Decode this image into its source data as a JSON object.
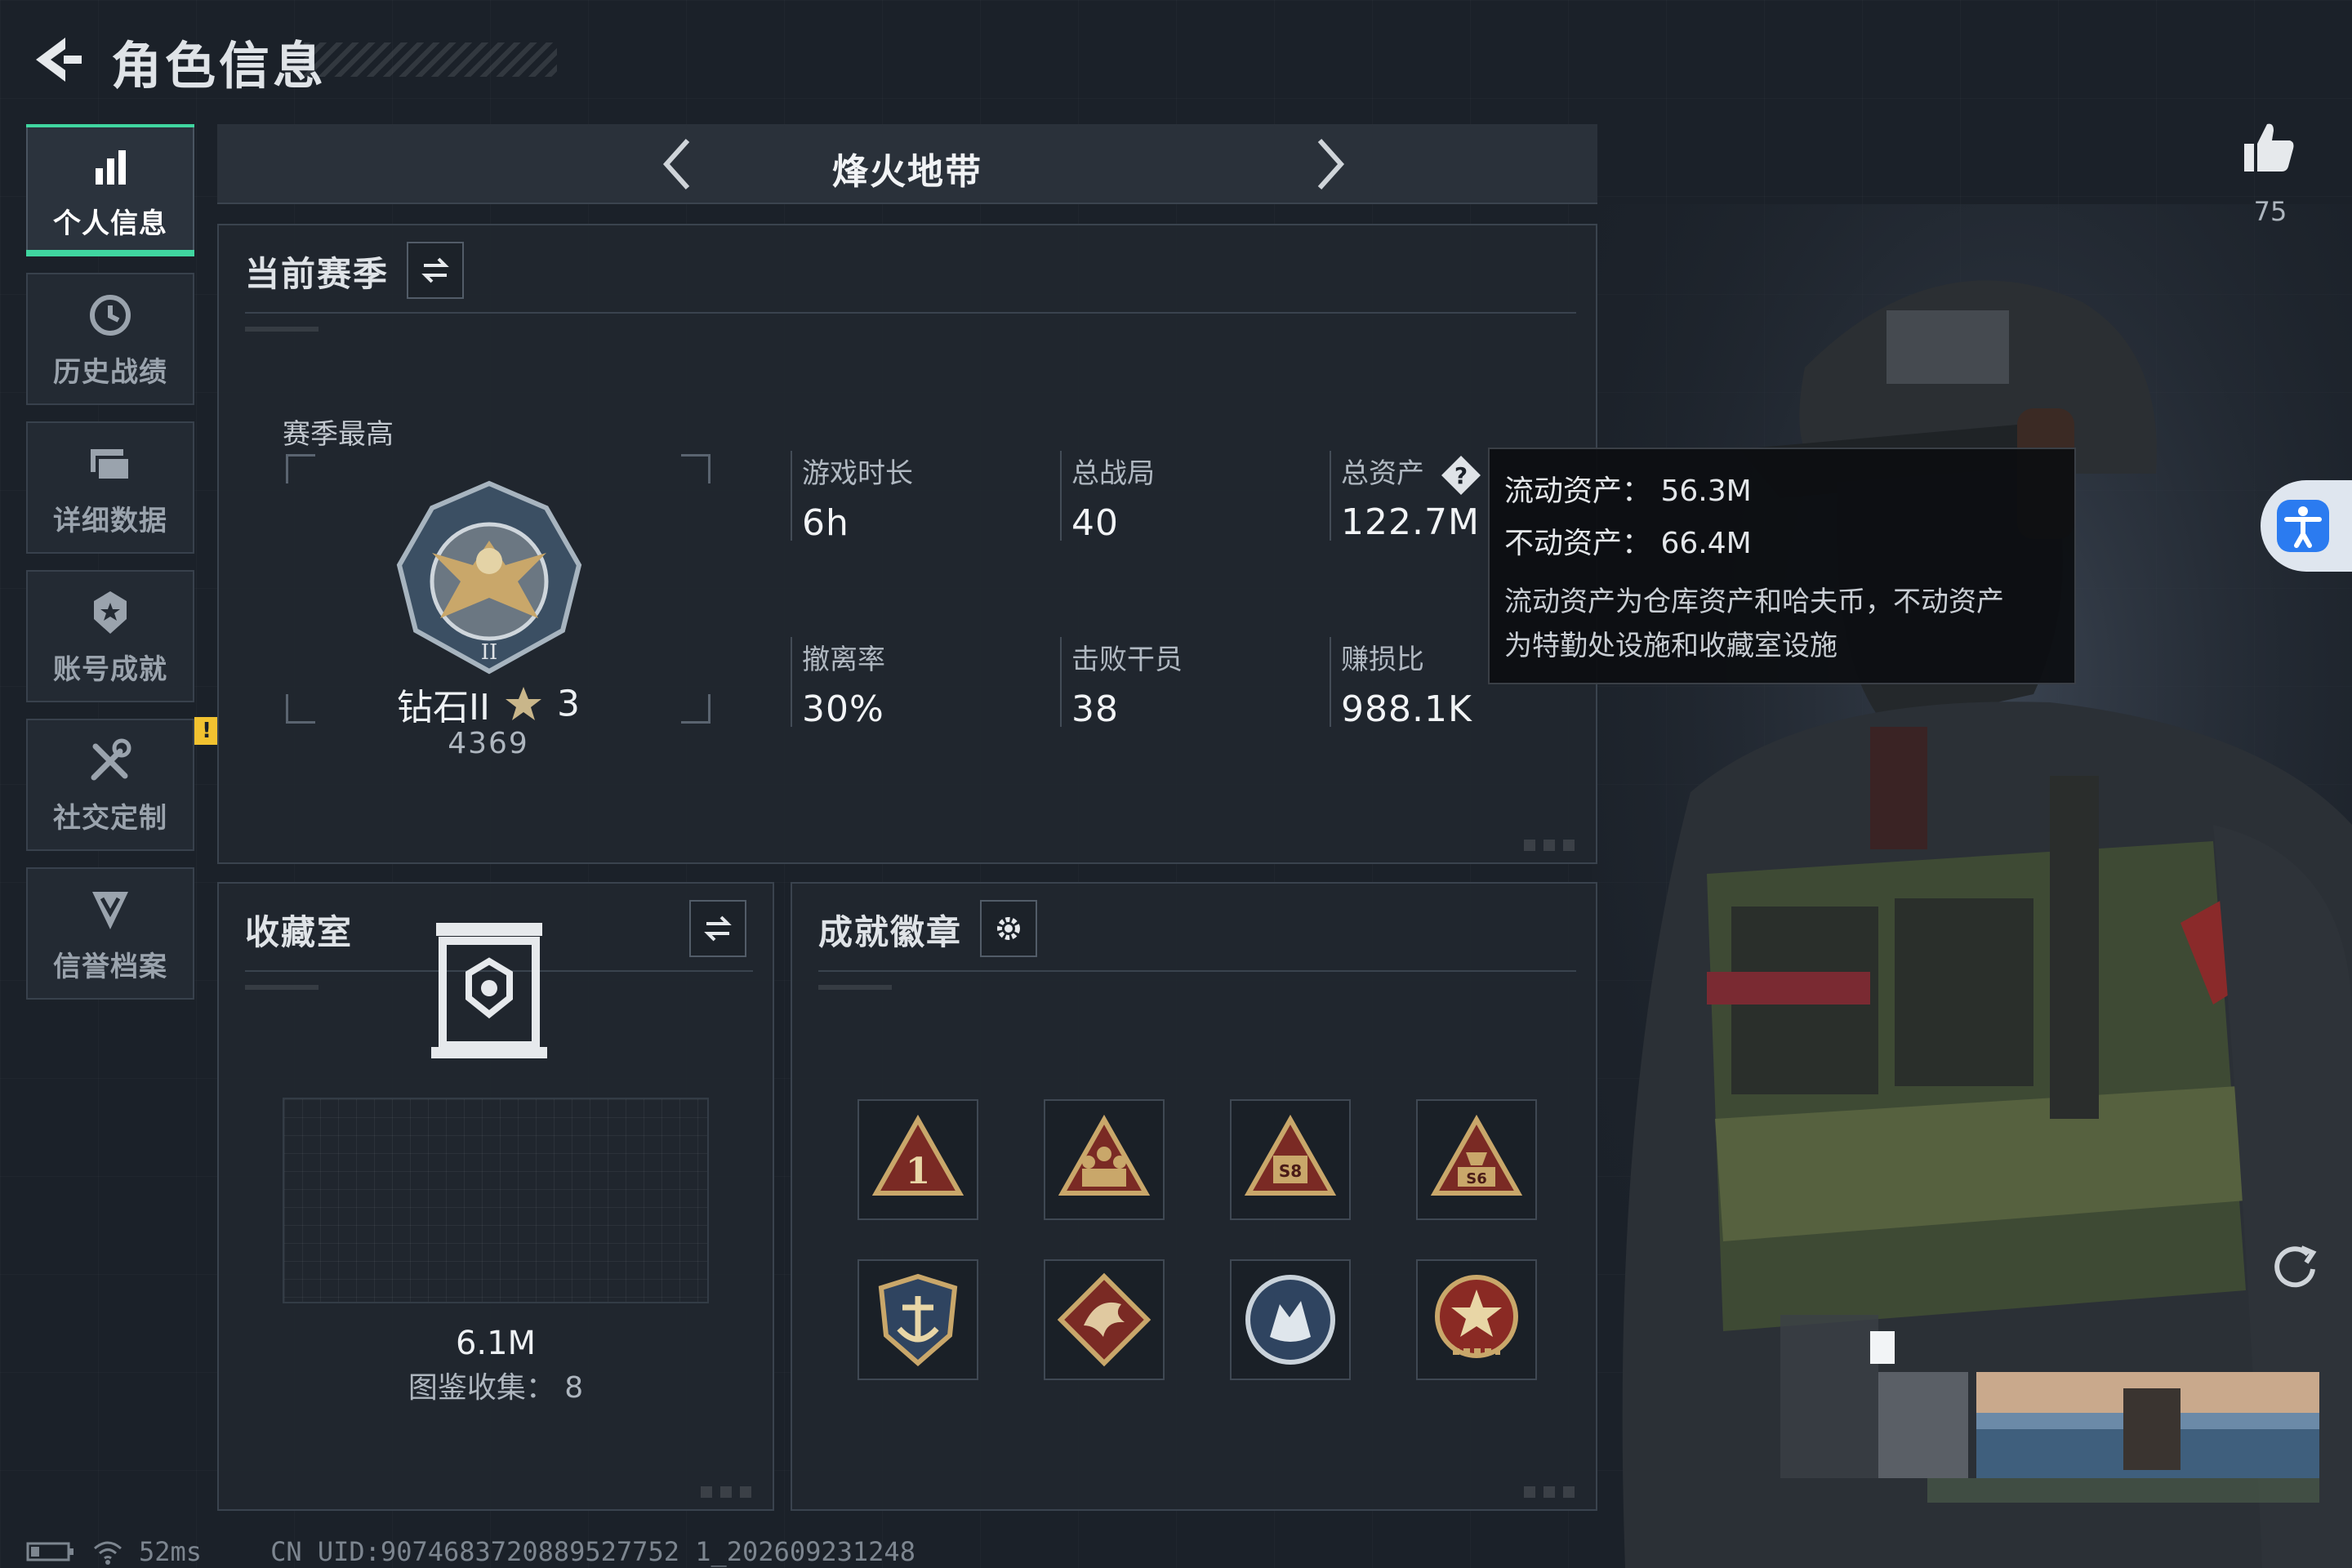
{
  "header": {
    "title": "角色信息"
  },
  "nav": {
    "items": [
      {
        "label": "个人信息",
        "icon": "bar-chart-icon",
        "active": true
      },
      {
        "label": "历史战绩",
        "icon": "history-clock-icon"
      },
      {
        "label": "详细数据",
        "icon": "folders-icon"
      },
      {
        "label": "账号成就",
        "icon": "medal-star-icon"
      },
      {
        "label": "社交定制",
        "icon": "tools-icon",
        "alert": "!"
      },
      {
        "label": "信誉档案",
        "icon": "shield-chevron-icon"
      }
    ]
  },
  "mode": {
    "label": "烽火地带"
  },
  "season": {
    "title": "当前赛季",
    "best_label": "赛季最高",
    "rank_name": "钻石II",
    "rank_stars": "3",
    "rank_points": "4369",
    "stats": [
      {
        "label": "游戏时长",
        "value": "6h"
      },
      {
        "label": "总战局",
        "value": "40"
      },
      {
        "label": "总资产",
        "value": "122.7M",
        "has_help": true
      },
      {
        "label": "撤离率",
        "value": "30%"
      },
      {
        "label": "击败干员",
        "value": "38"
      },
      {
        "label": "赚损比",
        "value": "988.1K"
      }
    ]
  },
  "tooltip": {
    "liquid": "流动资产：  56.3M",
    "fixed": "不动资产：  66.4M",
    "desc_line1": "流动资产为仓库资产和哈夫币，不动资产",
    "desc_line2": "为特勤处设施和收藏室设施"
  },
  "collection": {
    "title": "收藏室",
    "value": "6.1M",
    "count_label": "图鉴收集：  8"
  },
  "badges": {
    "title": "成就徽章",
    "items": [
      {
        "icon": "number-one-badge-icon"
      },
      {
        "icon": "squad-triangle-badge-icon"
      },
      {
        "icon": "s8-triangle-badge-icon",
        "text": "S8"
      },
      {
        "icon": "s6-triangle-badge-icon",
        "text": "S6"
      },
      {
        "icon": "anchor-shield-badge-icon"
      },
      {
        "icon": "dragon-diamond-badge-icon"
      },
      {
        "icon": "wolf-round-badge-icon"
      },
      {
        "icon": "star-medal-badge-icon"
      }
    ]
  },
  "like": {
    "count": "75"
  },
  "status": {
    "ping": "52ms",
    "uid": "CN UID:9074683720889527752 1_202609231248"
  },
  "colors": {
    "accent": "#40d6a0",
    "alert": "#f2c230",
    "badge_gold": "#c9a76a",
    "badge_red": "#7a2a24"
  }
}
